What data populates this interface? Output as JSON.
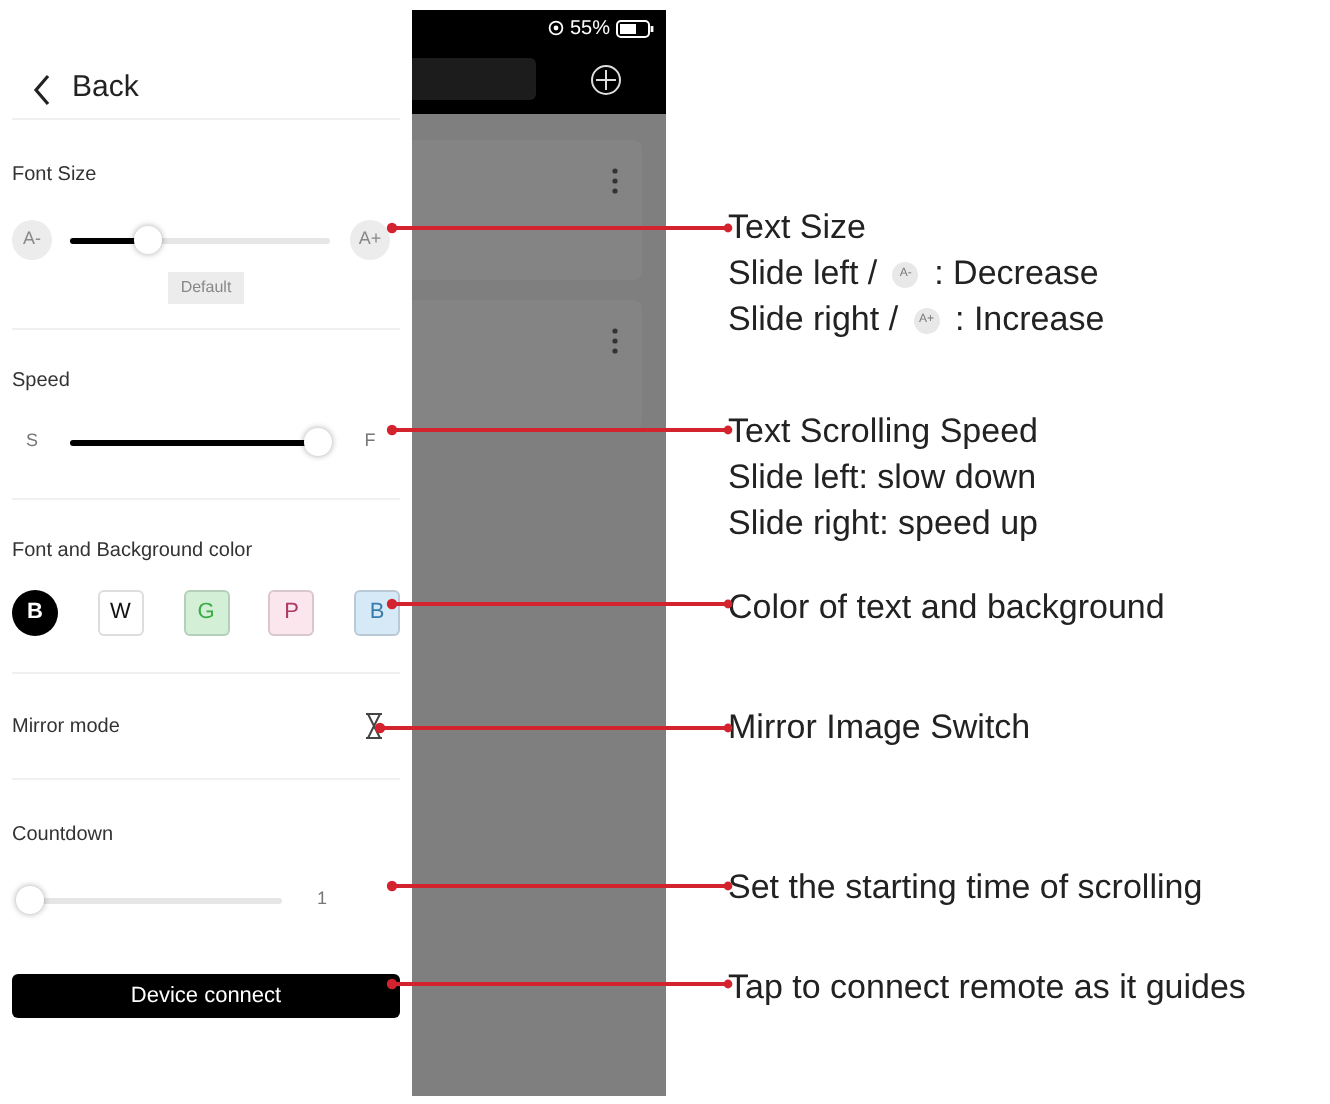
{
  "back": {
    "label": "Back"
  },
  "font_size": {
    "title": "Font Size",
    "min_label": "A-",
    "max_label": "A+",
    "level": 0.3,
    "badge": "Default"
  },
  "speed": {
    "title": "Speed",
    "min_label": "S",
    "max_label": "F",
    "level": 0.95
  },
  "colors": {
    "title": "Font and Background color",
    "options": [
      {
        "label": "B",
        "color": "#000000",
        "selected": true
      },
      {
        "label": "W",
        "color": "#ffffff",
        "selected": false
      },
      {
        "label": "G",
        "color": "#d3efd6",
        "selected": false
      },
      {
        "label": "P",
        "color": "#fbe6ee",
        "selected": false
      },
      {
        "label": "B",
        "color": "#d6e9f7",
        "selected": false
      }
    ]
  },
  "mirror": {
    "title": "Mirror mode"
  },
  "countdown": {
    "title": "Countdown",
    "level": 0.03,
    "value": "1"
  },
  "device_button": {
    "label": "Device connect"
  },
  "phone": {
    "battery": "55%"
  },
  "annotations": [
    {
      "lines": [
        {
          "text": "Text Size"
        },
        {
          "text": "Slide left /",
          "badge": "A-",
          "after": ": Decrease"
        },
        {
          "text": "Slide right /",
          "badge": "A+",
          "after": ": Increase"
        }
      ]
    },
    {
      "lines": [
        {
          "text": "Text Scrolling Speed"
        },
        {
          "text": "Slide left: slow down"
        },
        {
          "text": "Slide right: speed up"
        }
      ]
    },
    {
      "lines": [
        {
          "text": "Color of text and background"
        }
      ]
    },
    {
      "lines": [
        {
          "text": "Mirror Image Switch"
        }
      ]
    },
    {
      "lines": [
        {
          "text": "Set the starting time of scrolling"
        }
      ]
    },
    {
      "lines": [
        {
          "text": "Tap to connect remote as it guides"
        }
      ]
    }
  ]
}
